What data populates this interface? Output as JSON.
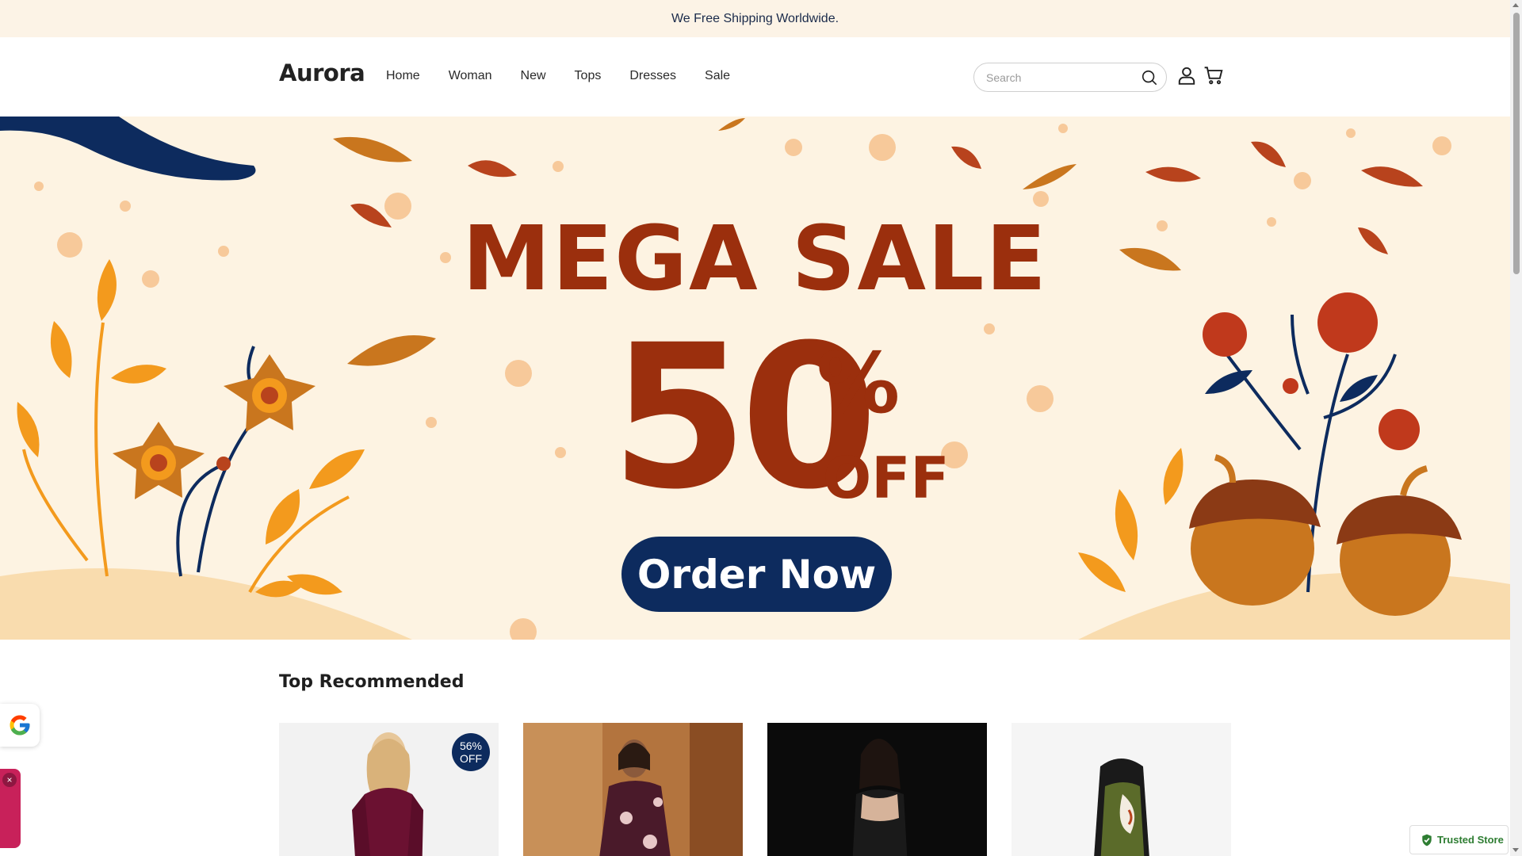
{
  "announcement": "We Free Shipping Worldwide.",
  "header": {
    "logo": "Aurora",
    "nav": [
      "Home",
      "Woman",
      "New",
      "Tops",
      "Dresses",
      "Sale"
    ],
    "search_placeholder": "Search",
    "icons": [
      "search-icon",
      "account-icon",
      "cart-icon"
    ]
  },
  "hero": {
    "headline": "MEGA SALE",
    "percent_number": "50",
    "percent_sign": "%",
    "off": "OFF",
    "cta": "Order Now"
  },
  "section": {
    "title": "Top Recommended",
    "products": [
      {
        "badge_line1": "56%",
        "badge_line2": "OFF",
        "theme": "burgundy velvet dress"
      },
      {
        "badge_line1": "",
        "badge_line2": "",
        "theme": "floral wrap dress"
      },
      {
        "badge_line1": "",
        "badge_line2": "",
        "theme": "black lingerie dress"
      },
      {
        "badge_line1": "",
        "badge_line2": "",
        "theme": "calla lily print dress"
      }
    ]
  },
  "widgets": {
    "trusted_store": "Trusted Store"
  },
  "colors": {
    "brand_navy": "#0d2b5e",
    "sale_red": "#9b2f0d",
    "announce_bg": "#fcf3e6",
    "hero_bg": "#fdf3e2"
  }
}
